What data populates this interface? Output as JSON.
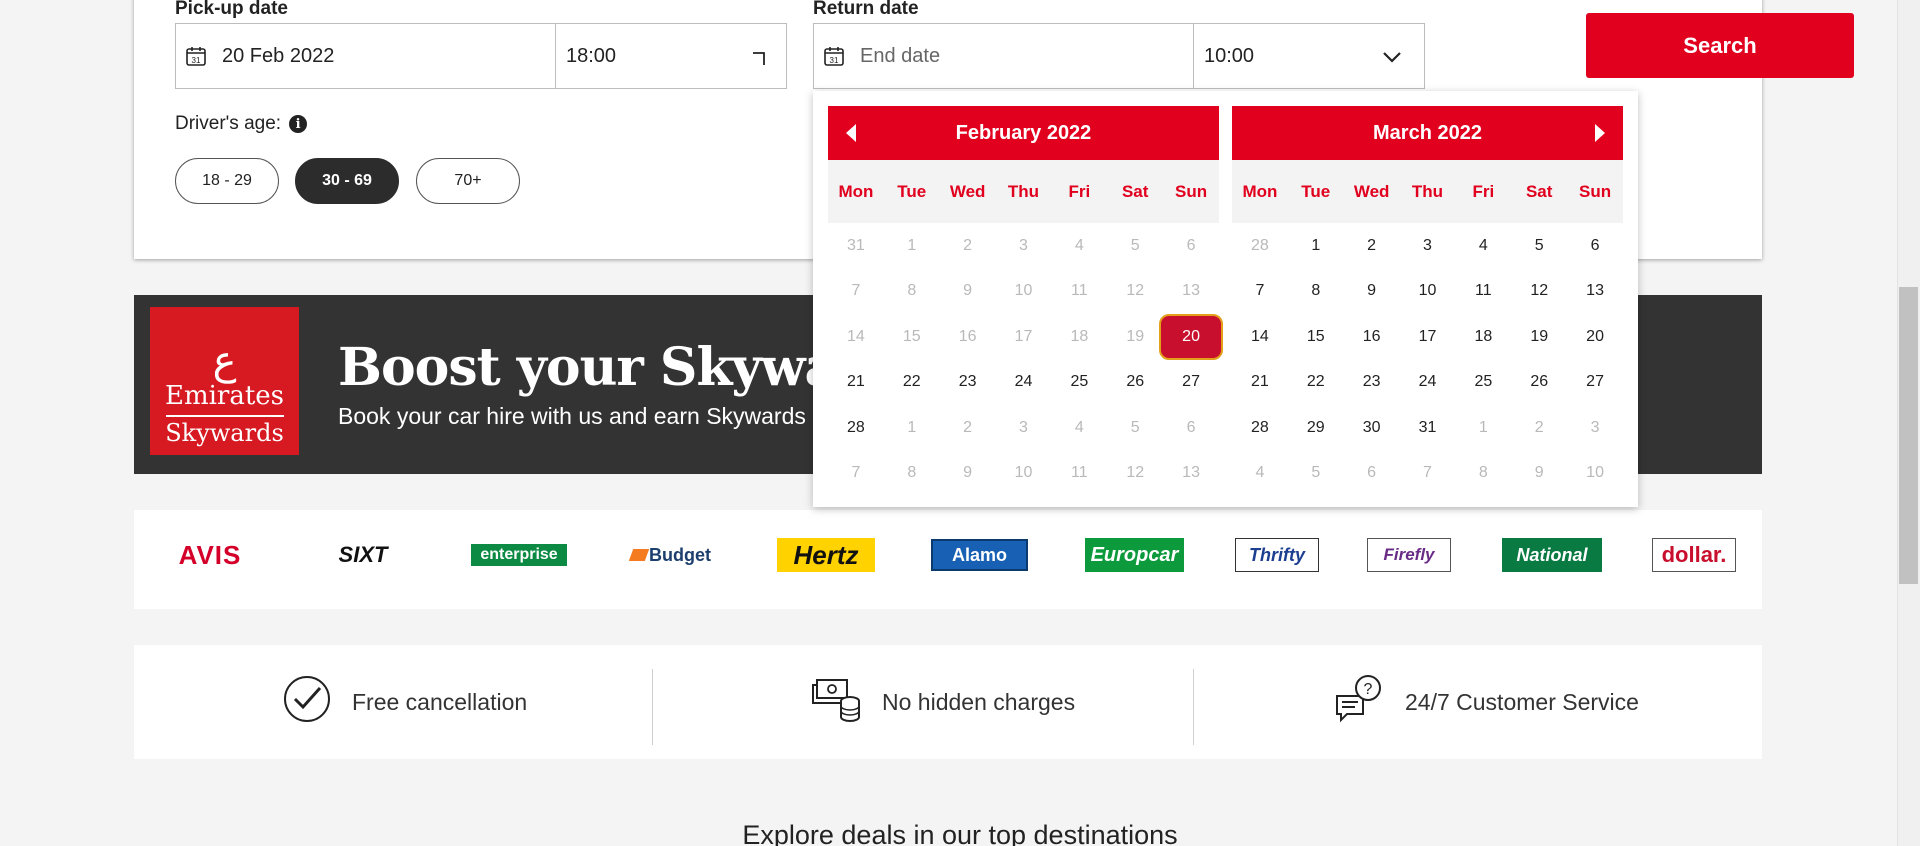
{
  "search": {
    "pickup_label": "Pick-up date",
    "pickup_date": "20 Feb 2022",
    "pickup_time": "18:00",
    "return_label": "Return date",
    "return_placeholder": "End date",
    "return_time": "10:00",
    "search_label": "Search",
    "calendar_icon_text": "31",
    "age_label": "Driver's age:",
    "info_icon_text": "i",
    "age_options": [
      "18 - 29",
      "30 - 69",
      "70+"
    ],
    "age_selected": "30 - 69"
  },
  "banner": {
    "logo_line1": "Emirates",
    "logo_line2": "Skywards",
    "title": "Boost your Skywards",
    "subtitle": "Book your car hire with us and earn Skywards"
  },
  "brands": [
    "AVIS",
    "SIXT",
    "enterprise",
    "Budget",
    "Hertz",
    "Alamo",
    "Europcar",
    "Thrifty",
    "Firefly",
    "National",
    "dollar."
  ],
  "usps": {
    "cancellation": "Free cancellation",
    "charges": "No hidden charges",
    "service": "24/7 Customer Service"
  },
  "explore": "Explore deals in our top destinations",
  "calendar": {
    "weekdays": [
      "Mon",
      "Tue",
      "Wed",
      "Thu",
      "Fri",
      "Sat",
      "Sun"
    ],
    "months": [
      {
        "title": "February 2022",
        "days": [
          [
            "31",
            "dim"
          ],
          [
            "1",
            "dim"
          ],
          [
            "2",
            "dim"
          ],
          [
            "3",
            "dim"
          ],
          [
            "4",
            "dim"
          ],
          [
            "5",
            "dim"
          ],
          [
            "6",
            "dim"
          ],
          [
            "7",
            "dim"
          ],
          [
            "8",
            "dim"
          ],
          [
            "9",
            "dim"
          ],
          [
            "10",
            "dim"
          ],
          [
            "11",
            "dim"
          ],
          [
            "12",
            "dim"
          ],
          [
            "13",
            "dim"
          ],
          [
            "14",
            "dim"
          ],
          [
            "15",
            "dim"
          ],
          [
            "16",
            "dim"
          ],
          [
            "17",
            "dim"
          ],
          [
            "18",
            "dim"
          ],
          [
            "19",
            "dim"
          ],
          [
            "20",
            "sel"
          ],
          [
            "21",
            ""
          ],
          [
            "22",
            ""
          ],
          [
            "23",
            ""
          ],
          [
            "24",
            ""
          ],
          [
            "25",
            ""
          ],
          [
            "26",
            ""
          ],
          [
            "27",
            ""
          ],
          [
            "28",
            ""
          ],
          [
            "1",
            "dim"
          ],
          [
            "2",
            "dim"
          ],
          [
            "3",
            "dim"
          ],
          [
            "4",
            "dim"
          ],
          [
            "5",
            "dim"
          ],
          [
            "6",
            "dim"
          ],
          [
            "7",
            "dim"
          ],
          [
            "8",
            "dim"
          ],
          [
            "9",
            "dim"
          ],
          [
            "10",
            "dim"
          ],
          [
            "11",
            "dim"
          ],
          [
            "12",
            "dim"
          ],
          [
            "13",
            "dim"
          ]
        ]
      },
      {
        "title": "March 2022",
        "days": [
          [
            "28",
            "dim"
          ],
          [
            "1",
            ""
          ],
          [
            "2",
            ""
          ],
          [
            "3",
            ""
          ],
          [
            "4",
            ""
          ],
          [
            "5",
            ""
          ],
          [
            "6",
            ""
          ],
          [
            "7",
            ""
          ],
          [
            "8",
            ""
          ],
          [
            "9",
            ""
          ],
          [
            "10",
            ""
          ],
          [
            "11",
            ""
          ],
          [
            "12",
            ""
          ],
          [
            "13",
            ""
          ],
          [
            "14",
            ""
          ],
          [
            "15",
            ""
          ],
          [
            "16",
            ""
          ],
          [
            "17",
            ""
          ],
          [
            "18",
            ""
          ],
          [
            "19",
            ""
          ],
          [
            "20",
            ""
          ],
          [
            "21",
            ""
          ],
          [
            "22",
            ""
          ],
          [
            "23",
            ""
          ],
          [
            "24",
            ""
          ],
          [
            "25",
            ""
          ],
          [
            "26",
            ""
          ],
          [
            "27",
            ""
          ],
          [
            "28",
            ""
          ],
          [
            "29",
            ""
          ],
          [
            "30",
            ""
          ],
          [
            "31",
            ""
          ],
          [
            "1",
            "dim"
          ],
          [
            "2",
            "dim"
          ],
          [
            "3",
            "dim"
          ],
          [
            "4",
            "dim"
          ],
          [
            "5",
            "dim"
          ],
          [
            "6",
            "dim"
          ],
          [
            "7",
            "dim"
          ],
          [
            "8",
            "dim"
          ],
          [
            "9",
            "dim"
          ],
          [
            "10",
            "dim"
          ]
        ]
      }
    ]
  },
  "colors": {
    "accent": "#e1001e",
    "dark": "#333333",
    "selected_border": "#e3a01b"
  }
}
